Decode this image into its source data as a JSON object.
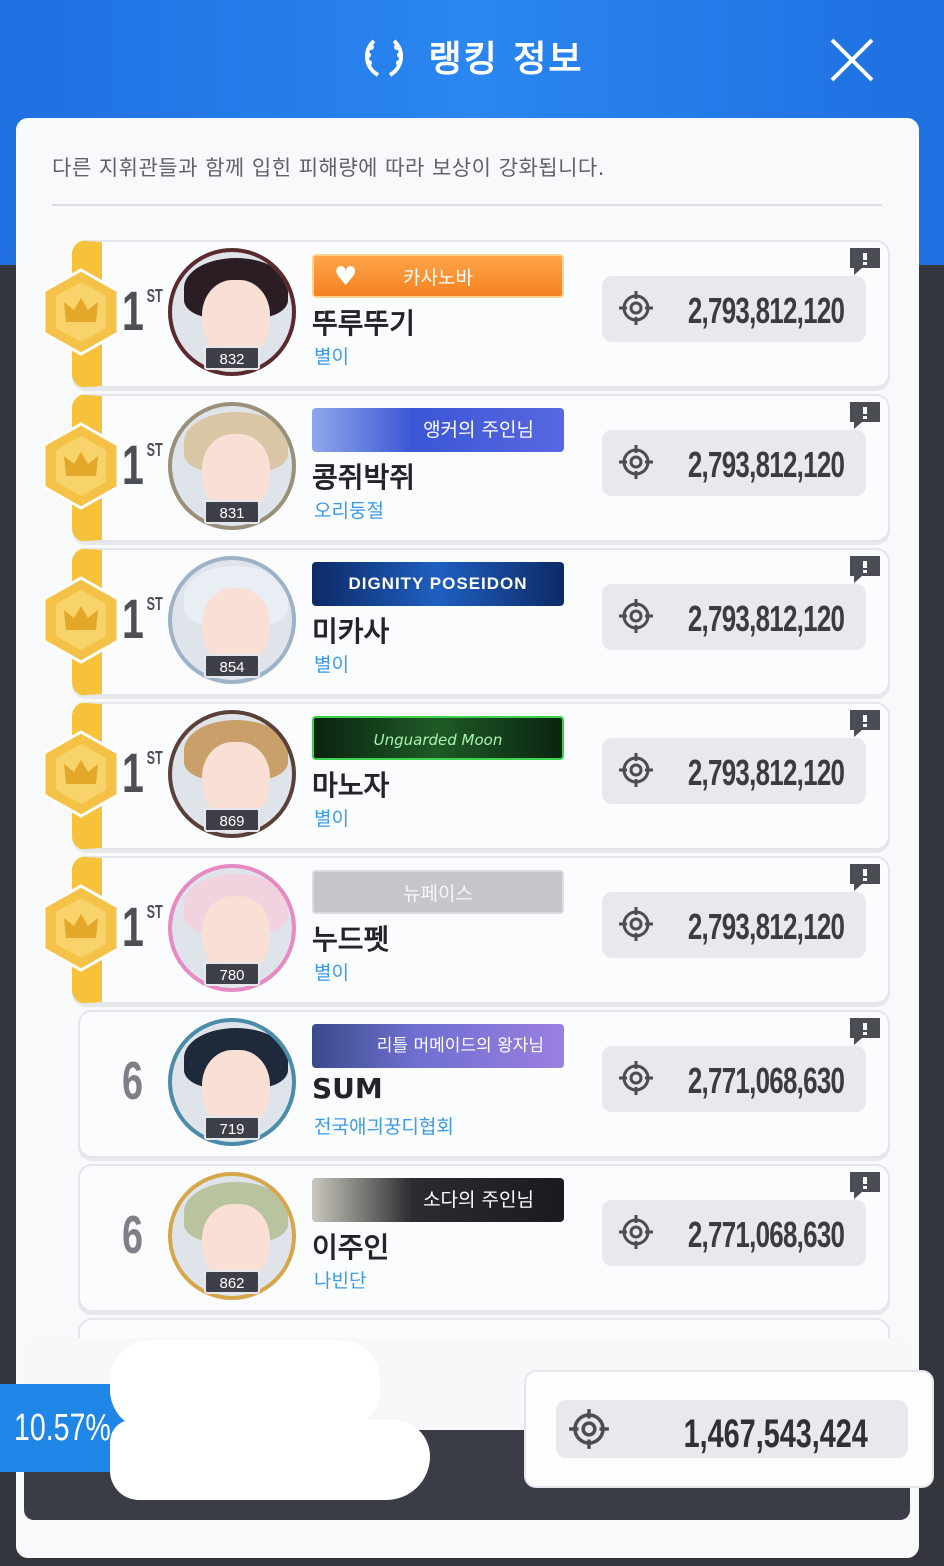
{
  "header": {
    "title": "랭킹 정보"
  },
  "description": "다른 지휘관들과 함께 입힌 피해량에 따라 보상이 강화됩니다.",
  "rows": [
    {
      "rank": "1",
      "rank_suffix": "ST",
      "level": "832",
      "banner": "카사노바",
      "name": "뚜루뚜기",
      "guild": "별이",
      "score": "2,793,812,120"
    },
    {
      "rank": "1",
      "rank_suffix": "ST",
      "level": "831",
      "banner": "앵커의 주인님",
      "name": "콩쥐박쥐",
      "guild": "오리둥절",
      "score": "2,793,812,120"
    },
    {
      "rank": "1",
      "rank_suffix": "ST",
      "level": "854",
      "banner": "DIGNITY POSEIDON",
      "name": "미카사",
      "guild": "별이",
      "score": "2,793,812,120"
    },
    {
      "rank": "1",
      "rank_suffix": "ST",
      "level": "869",
      "banner": "Unguarded Moon",
      "name": "마노자",
      "guild": "별이",
      "score": "2,793,812,120"
    },
    {
      "rank": "1",
      "rank_suffix": "ST",
      "level": "780",
      "banner": "뉴페이스",
      "name": "누드펫",
      "guild": "별이",
      "score": "2,793,812,120"
    },
    {
      "rank": "6",
      "level": "719",
      "banner": "리틀 머메이드의 왕자님",
      "name": "SUM",
      "guild": "전국애긔꿍디협회",
      "score": "2,771,068,630"
    },
    {
      "rank": "6",
      "level": "862",
      "banner": "소다의 주인님",
      "name": "이주인",
      "guild": "나빈단",
      "score": "2,771,068,630"
    }
  ],
  "my_rank": {
    "percent": "10.57%",
    "score": "1,467,543,424"
  },
  "colors": {
    "accent": "#1f86e8",
    "gold": "#f6c23b",
    "guild_text": "#3b9ae8"
  },
  "icons": {
    "close": "close-icon",
    "laurel": "laurel-icon",
    "target": "target-icon",
    "chat": "chat-icon",
    "medal": "crown-medal-icon",
    "heart": "heart-icon"
  }
}
